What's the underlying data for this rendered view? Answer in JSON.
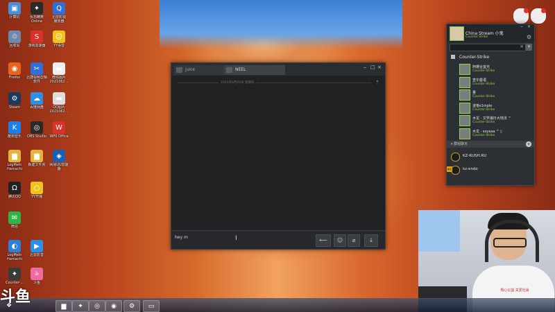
{
  "desktop_icons": [
    {
      "label": "计算机",
      "icon": "computer-icon",
      "color": "#4a8fd8",
      "glyph": "▣"
    },
    {
      "label": "反恐精英\nOnline",
      "icon": "csol-icon",
      "color": "#2a2a2a",
      "glyph": "✦"
    },
    {
      "label": "迅雷影视\n播放器",
      "icon": "qfd-icon",
      "color": "#2f6fd6",
      "glyph": "Q"
    },
    {
      "label": "回收站",
      "icon": "recycle-bin-icon",
      "color": "#6f8aa8",
      "glyph": "♲"
    },
    {
      "label": "游戏加速器",
      "icon": "accelerator-icon",
      "color": "#d8322c",
      "glyph": "S"
    },
    {
      "label": "YY语音",
      "icon": "yy-icon",
      "color": "#f0c21c",
      "glyph": "☺"
    },
    {
      "label": "Firefox",
      "icon": "firefox-icon",
      "color": "#e8641c",
      "glyph": "◉"
    },
    {
      "label": "迅捷视频剪辑\n软件",
      "icon": "video-editor-icon",
      "color": "#2f6fd6",
      "glyph": "✂"
    },
    {
      "label": "微信图片\n2021062...",
      "icon": "image-file-icon",
      "color": "#eeeeee",
      "glyph": "▬"
    },
    {
      "label": "Steam",
      "icon": "steam-icon",
      "color": "#1b3a5c",
      "glyph": "⚙"
    },
    {
      "label": "百度网盘",
      "icon": "baidu-disk-icon",
      "color": "#2f8fe6",
      "glyph": "☁"
    },
    {
      "label": "QQ图片\n2021062...",
      "icon": "image-file-icon",
      "color": "#dddddd",
      "glyph": "▬"
    },
    {
      "label": "酷狗音乐",
      "icon": "kugou-icon",
      "color": "#1c7ee8",
      "glyph": "K"
    },
    {
      "label": "OBS Studio",
      "icon": "obs-icon",
      "color": "#2a2a2a",
      "glyph": "◎"
    },
    {
      "label": "WPS Office",
      "icon": "wps-icon",
      "color": "#d8322c",
      "glyph": "W"
    },
    {
      "label": "LogMeIn\nHamachi",
      "icon": "folder-icon",
      "color": "#e6b43c",
      "glyph": "▆"
    },
    {
      "label": "新建文件夹",
      "icon": "folder-icon",
      "color": "#e6b43c",
      "glyph": "▆"
    },
    {
      "label": "网易UU加速\n器",
      "icon": "uu-icon",
      "color": "#1a5fb0",
      "glyph": "◈"
    },
    {
      "label": "腾讯QQ",
      "icon": "qq-icon",
      "color": "#222222",
      "glyph": "Ω"
    },
    {
      "label": "YY开播",
      "icon": "yy-live-icon",
      "color": "#f0c21c",
      "glyph": "○"
    },
    {
      "label": "微信",
      "icon": "wechat-icon",
      "color": "#2fb44a",
      "glyph": "✉"
    },
    {
      "label": "LogMeIn\nHamachi",
      "icon": "hamachi-icon",
      "color": "#2f7fd8",
      "glyph": "◐"
    },
    {
      "label": "迅雷影音",
      "icon": "xunlei-player-icon",
      "color": "#2f8fe6",
      "glyph": "▶"
    },
    {
      "label": "Counter-...",
      "icon": "cs-icon",
      "color": "#3a3a3a",
      "glyph": "✦"
    },
    {
      "label": "斗鱼",
      "icon": "douyu-icon",
      "color": "#f06aa0",
      "glyph": "ঌ"
    }
  ],
  "chat": {
    "tabs": [
      {
        "label": "juice",
        "close": "×"
      },
      {
        "label": "NEEL",
        "close": "×"
      }
    ],
    "window_controls": [
      "‒",
      "□",
      "×"
    ],
    "date_separator": "2021年6月20日 星期日",
    "compose_text": "hey m",
    "send_icon": "⟵",
    "emoji_icon": "☺",
    "attach_icon": "⌀",
    "more_icon": "↓"
  },
  "friends": {
    "user_name": "China Stream 小鬼",
    "user_status": "Counter-Strike",
    "search_placeholder": "",
    "search_clear": "×",
    "add_label": "+",
    "gear": "⚙",
    "window_controls": [
      "‒",
      "×"
    ],
    "group_header": "Counter-Strike",
    "list": [
      {
        "name": "阿珊合宜光",
        "game": "Counter-Strike"
      },
      {
        "name": "查尔曼语",
        "game": "Counter-Strike"
      },
      {
        "name": "量",
        "game": "Counter-Strike"
      },
      {
        "name": "凌恪s1mple",
        "game": "Counter-Strike"
      },
      {
        "name": "木龙 · 文学浦日大地法 ^",
        "game": "Counter-Strike"
      },
      {
        "name": "木龙 · soyaaa ^ ▯",
        "game": "Counter-Strike"
      }
    ],
    "section_label": "▾ 群组聊天",
    "section_plus": "+",
    "groups": [
      {
        "name": "KZ-RUSH.RU"
      },
      {
        "name": "kz-endo"
      }
    ],
    "group_tag": "聊天"
  },
  "overlay": {
    "logo_text": "斗鱼"
  },
  "webcam": {
    "shirt_text": "热心公益 关爱社会"
  },
  "taskbar": {
    "items": [
      {
        "icon": "windows-start-icon",
        "glyph": "❖"
      },
      {
        "icon": "explorer-icon",
        "glyph": "▆"
      },
      {
        "icon": "csol-icon",
        "glyph": "✦"
      },
      {
        "icon": "obs-icon",
        "glyph": "◎"
      },
      {
        "icon": "firefox-icon",
        "glyph": "◉"
      },
      {
        "icon": "steam-icon",
        "glyph": "⚙"
      },
      {
        "icon": "steam-chat-icon",
        "glyph": "▭"
      }
    ]
  }
}
